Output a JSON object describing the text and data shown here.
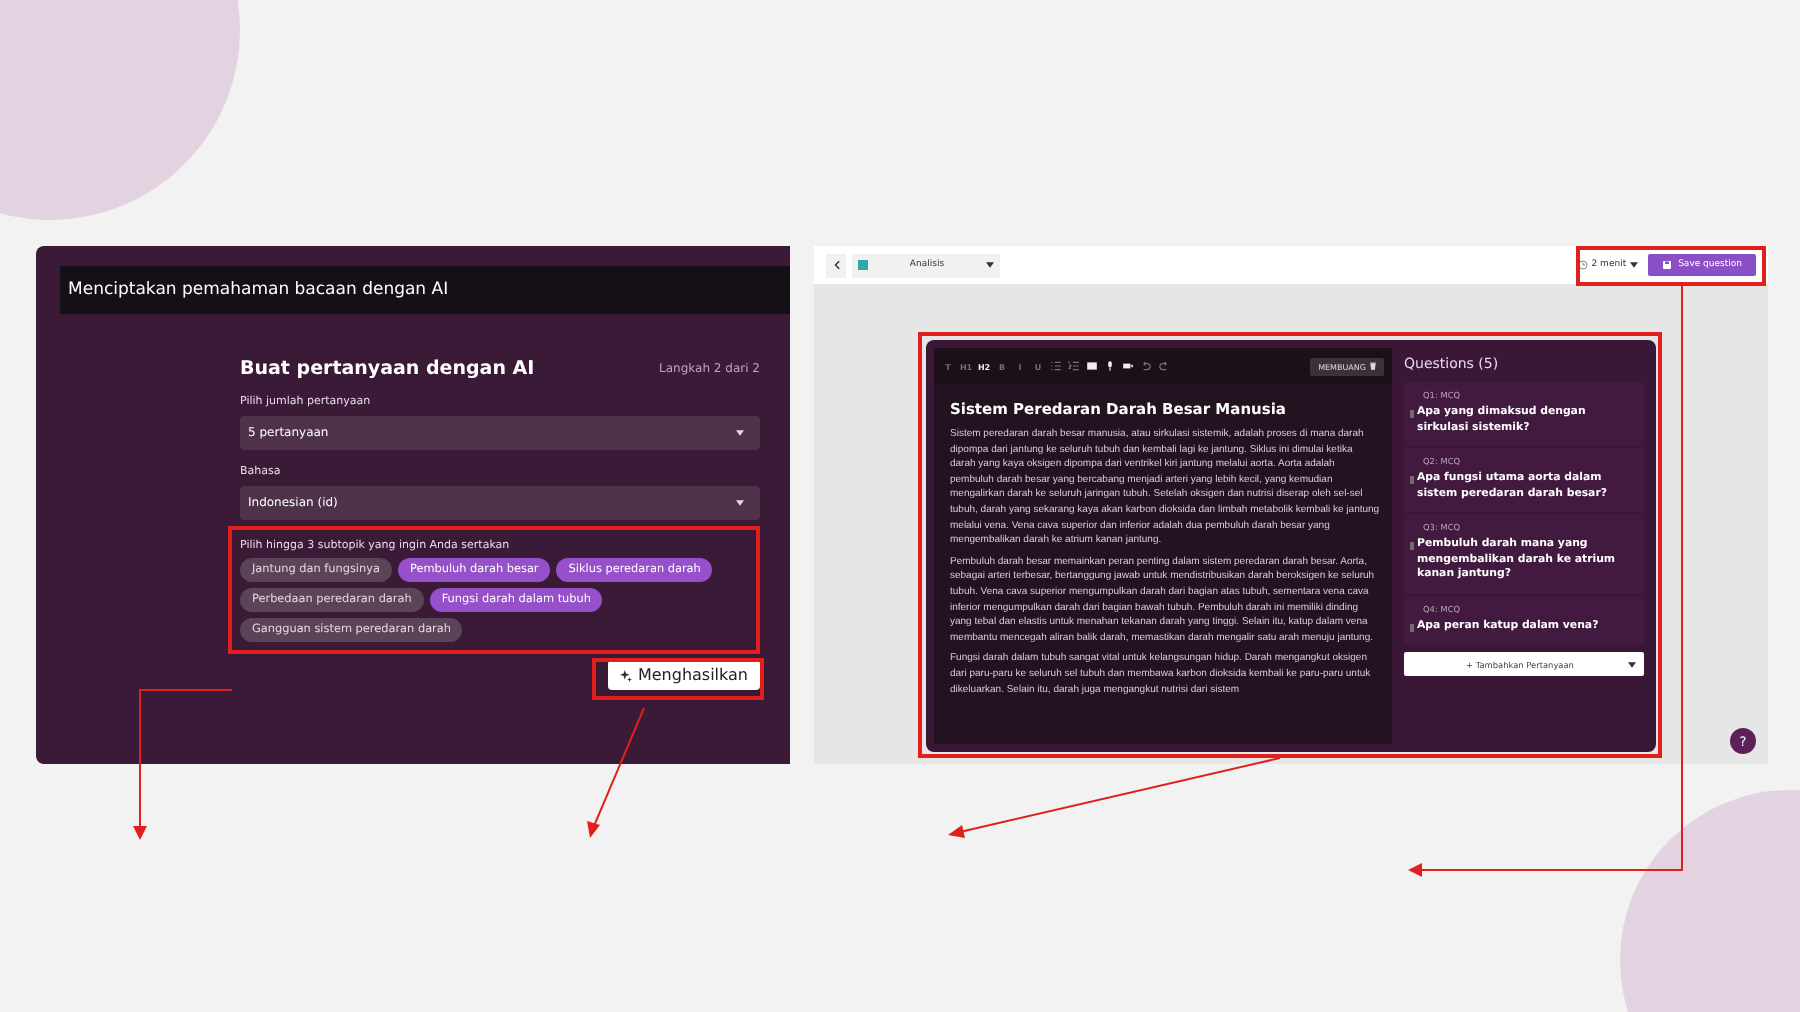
{
  "left_window": {
    "title": "Menciptakan pemahaman bacaan dengan AI",
    "form": {
      "heading": "Buat pertanyaan dengan AI",
      "step": "Langkah 2 dari 2",
      "fields": [
        {
          "label": "Pilih jumlah pertanyaan",
          "value": "5 pertanyaan"
        },
        {
          "label": "Bahasa",
          "value": "Indonesian (id)"
        }
      ],
      "subtopics": {
        "label": "Pilih hingga 3 subtopik yang ingin Anda sertakan",
        "chips": [
          {
            "label": "Jantung dan fungsinya",
            "selected": false
          },
          {
            "label": "Pembuluh darah besar",
            "selected": true
          },
          {
            "label": "Siklus peredaran darah",
            "selected": true
          },
          {
            "label": "Perbedaan peredaran darah",
            "selected": false
          },
          {
            "label": "Fungsi darah dalam tubuh",
            "selected": true
          },
          {
            "label": "Gangguan sistem peredaran darah",
            "selected": false
          }
        ]
      },
      "generate_button": "Menghasilkan"
    }
  },
  "right_window": {
    "top_bar": {
      "document": "Analisis",
      "time": "2 menit",
      "save_button": "Save question"
    },
    "editor": {
      "toolbar": [
        {
          "kind": "text",
          "label": "T",
          "selected": false
        },
        {
          "kind": "text",
          "label": "H1",
          "selected": false
        },
        {
          "kind": "text",
          "label": "H2",
          "selected": true
        },
        {
          "kind": "text",
          "label": "B",
          "selected": false
        },
        {
          "kind": "text",
          "label": "I",
          "selected": false
        },
        {
          "kind": "text",
          "label": "U",
          "selected": false
        },
        {
          "kind": "bullets",
          "selected": false
        },
        {
          "kind": "numbers",
          "selected": false
        },
        {
          "kind": "image",
          "selected": true
        },
        {
          "kind": "mic",
          "selected": true
        },
        {
          "kind": "video",
          "selected": true
        },
        {
          "kind": "undo",
          "selected": false
        },
        {
          "kind": "redo",
          "selected": false
        }
      ],
      "discard_button": "MEMBUANG",
      "title": "Sistem Peredaran Darah Besar Manusia",
      "paragraphs": [
        "Sistem peredaran darah besar manusia, atau sirkulasi sistemik, adalah proses di mana darah dipompa dari jantung ke seluruh tubuh dan kembali lagi ke jantung. Siklus ini dimulai ketika darah yang kaya oksigen dipompa dari ventrikel kiri jantung melalui aorta. Aorta adalah pembuluh darah besar yang bercabang menjadi arteri yang lebih kecil, yang kemudian mengalirkan darah ke seluruh jaringan tubuh. Setelah oksigen dan nutrisi diserap oleh sel-sel tubuh, darah yang sekarang kaya akan karbon dioksida dan limbah metabolik kembali ke jantung melalui vena. Vena cava superior dan inferior adalah dua pembuluh darah besar yang mengembalikan darah ke atrium kanan jantung.",
        "Pembuluh darah besar memainkan peran penting dalam sistem peredaran darah besar. Aorta, sebagai arteri terbesar, bertanggung jawab untuk mendistribusikan darah beroksigen ke seluruh tubuh. Vena cava superior mengumpulkan darah dari bagian atas tubuh, sementara vena cava inferior mengumpulkan darah dari bagian bawah tubuh. Pembuluh darah ini memiliki dinding yang tebal dan elastis untuk menahan tekanan darah yang tinggi. Selain itu, katup dalam vena membantu mencegah aliran balik darah, memastikan darah mengalir satu arah menuju jantung.",
        "Fungsi darah dalam tubuh sangat vital untuk kelangsungan hidup. Darah mengangkut oksigen dari paru-paru ke seluruh sel tubuh dan membawa karbon dioksida kembali ke paru-paru untuk dikeluarkan. Selain itu, darah juga mengangkut nutrisi dari sistem"
      ]
    },
    "questions": {
      "title": "Questions (5)",
      "items": [
        {
          "number": "Q1: MCQ",
          "text": "Apa yang dimaksud dengan sirkulasi sistemik?"
        },
        {
          "number": "Q2: MCQ",
          "text": "Apa fungsi utama aorta dalam sistem peredaran darah besar?"
        },
        {
          "number": "Q3: MCQ",
          "text": "Pembuluh darah mana yang mengembalikan darah ke atrium kanan jantung?"
        },
        {
          "number": "Q4: MCQ",
          "text": "Apa peran katup dalam vena?"
        }
      ],
      "add_button": "+ Tambahkan Pertanyaan"
    },
    "help_button": "?"
  }
}
